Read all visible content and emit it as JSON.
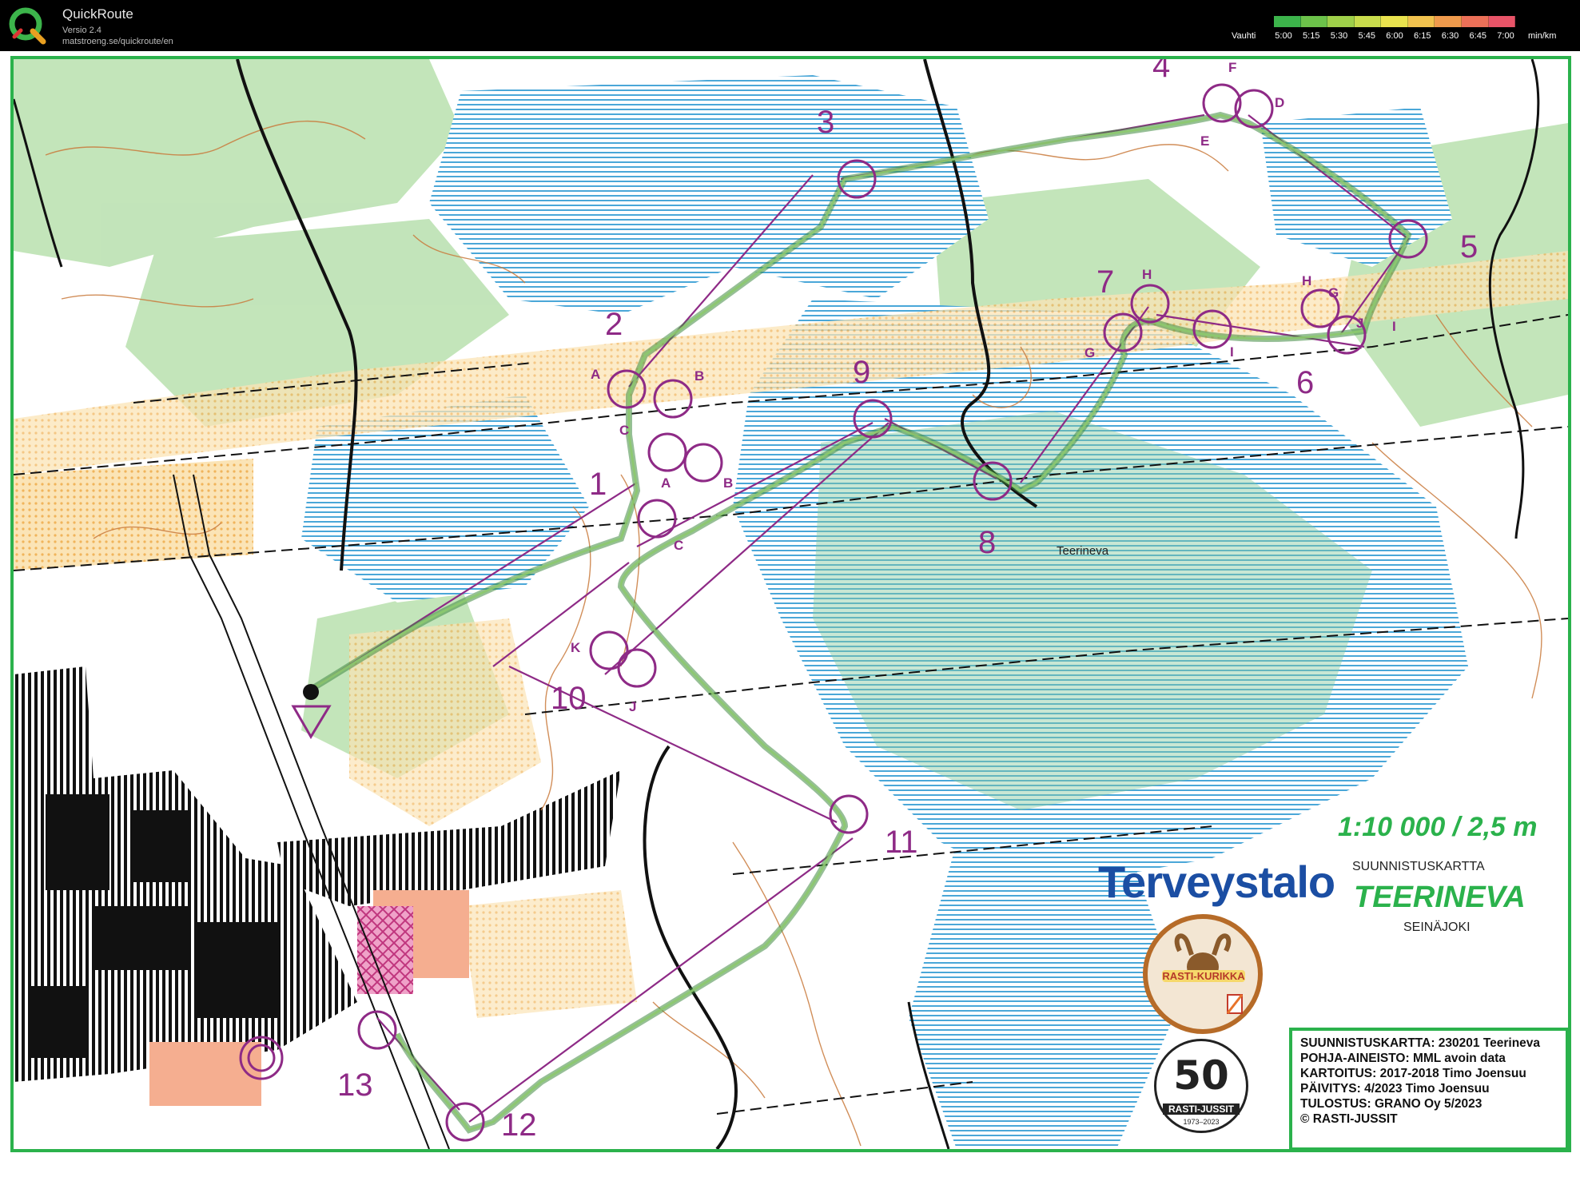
{
  "app": {
    "name": "QuickRoute",
    "version": "Versio 2.4",
    "url": "matstroeng.se/quickroute/en"
  },
  "pace_legend": {
    "label": "Vauhti",
    "ticks": [
      "5:00",
      "5:15",
      "5:30",
      "5:45",
      "6:00",
      "6:15",
      "6:30",
      "6:45",
      "7:00"
    ],
    "unit": "min/km",
    "colors": [
      "#3cb44b",
      "#6cc24a",
      "#9fd04a",
      "#c9dc4c",
      "#e9e24e",
      "#f1c24e",
      "#ef9a4c",
      "#ec7058",
      "#e85468"
    ]
  },
  "map": {
    "scale": "1:10 000 / 2,5 m",
    "sponsor": "Terveystalo",
    "map_type": "SUUNNISTUSKARTTA",
    "map_name": "TEERINEVA",
    "city": "SEINÄJOKI",
    "area_label": "Teerineva",
    "club_badge_text": "RASTI-KURIKKA",
    "anniversary_badge": {
      "number": "50",
      "label": "RASTI-JUSSIT",
      "years": "1973–2023"
    },
    "info_lines": [
      "SUUNNISTUSKARTTA: 230201 Teerineva",
      "POHJA-AINEISTO: MML avoin data",
      "KARTOITUS: 2017-2018 Timo Joensuu",
      "PÄIVITYS: 4/2023 Timo Joensuu",
      "TULOSTUS: GRANO Oy 5/2023",
      "© RASTI-JUSSIT"
    ],
    "control_numbers": [
      "1",
      "2",
      "3",
      "4",
      "5",
      "6",
      "7",
      "8",
      "9",
      "10",
      "11",
      "12",
      "13"
    ],
    "control_letters": [
      "A",
      "B",
      "C",
      "A",
      "B",
      "C",
      "F",
      "D",
      "E",
      "H",
      "H",
      "G",
      "G",
      "I",
      "J",
      "I",
      "K",
      "J"
    ]
  },
  "colors": {
    "frame_green": "#2bb24c",
    "course_purple": "#8e2a86",
    "route_green": "#3f8a3f",
    "marsh_blue": "#4aa7d8",
    "open_yellow": "#f7cf7c",
    "forest_green": "#9fd69b"
  }
}
